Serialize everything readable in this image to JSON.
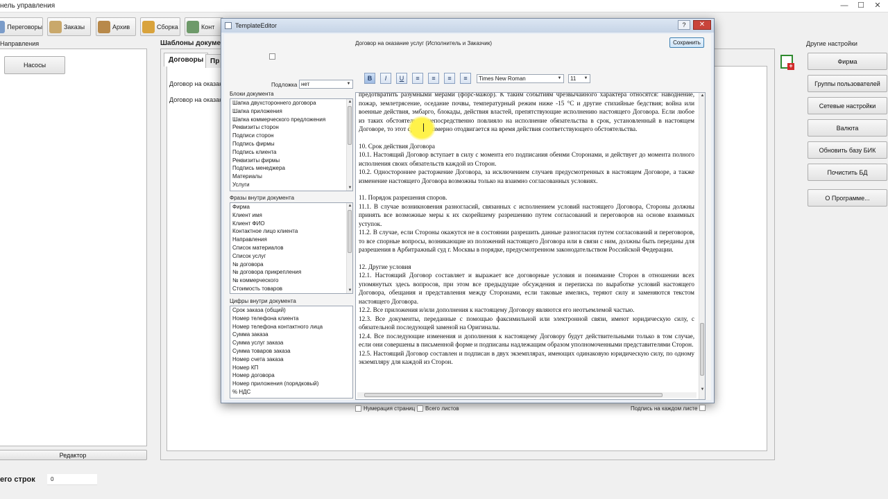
{
  "window": {
    "title": "нель управления"
  },
  "toolbar": {
    "items": [
      {
        "label": "Переговоры",
        "icon": "chat-icon"
      },
      {
        "label": "Заказы",
        "icon": "cart-icon"
      },
      {
        "label": "Архив",
        "icon": "box-icon"
      },
      {
        "label": "Сборка",
        "icon": "tools-icon"
      },
      {
        "label": "Конт",
        "icon": "contacts-icon"
      }
    ]
  },
  "left": {
    "section": "Направления",
    "items": [
      "Насосы"
    ],
    "editor_button": "Редактор"
  },
  "templates": {
    "title": "Шаблоны докумен",
    "tabs": [
      "Договоры",
      "Пр"
    ],
    "docs": [
      "Договор на оказани",
      "Договор на оказани"
    ]
  },
  "footer": {
    "rows_label": "его строк",
    "rows_value": "0"
  },
  "settings": {
    "title": "Другие настройки",
    "buttons": [
      "Фирма",
      "Группы пользователей",
      "Сетевые настройки",
      "Валюта",
      "Обновить базу БИК",
      "Почистить БД",
      "О Программе..."
    ]
  },
  "dialog": {
    "title": "TemplateEditor",
    "help": "?",
    "close": "✕",
    "doc_name": "Договор на оказание услуг (Исполнитель и Заказчик)",
    "save": "Сохранить",
    "substrate_label": "Подложка",
    "substrate_value": "нет",
    "blocks_label": "Блоки документа",
    "blocks": [
      "Шапка двухстороннего договора",
      "Шапка приложения",
      "Шапка коммерческого предложения",
      "Реквизиты сторон",
      "Подписи сторон",
      "Подпись фирмы",
      "Подпись клиента",
      "Реквизиты фирмы",
      "Подпись менеджера",
      "Материалы",
      "Услуги"
    ],
    "phrases_label": "Фразы внутри документа",
    "phrases": [
      "Фирма",
      "Клиент имя",
      "Клиент ФИО",
      "Контактное лицо клиента",
      "Направления",
      "Список материалов",
      "Список услуг",
      "№ договора",
      "№ договора прикрепления",
      "№ коммерческого",
      "Стоимость товаров"
    ],
    "numbers_label": "Цифры внутри документа",
    "numbers": [
      "Срок заказа (общий)",
      "Номер телефона клиента",
      "Номер телефона контактного лица",
      "Сумма заказа",
      "Сумма услуг заказа",
      "Сумма товаров заказа",
      "Номер счета заказа",
      "Номер КП",
      "Номер договора",
      "Номер приложения (порядковый)",
      "% НДС"
    ],
    "font": "Times New Roman",
    "size": "11",
    "format_buttons": [
      "B",
      "I",
      "U",
      "≡",
      "≡",
      "≡",
      "≡"
    ],
    "page_numbering": "Нумерация страниц",
    "total_sheets": "Всего листов",
    "sign_each": "Подпись на каждом листе",
    "text": [
      "предотвратить разумными мерами (форс-мажор). К таким событиям чрезвычайного характера относятся: наводнение, пожар, землетрясение, оседание почвы, температурный режим ниже -15 °С и другие стихийные бедствия; война или военные действия, эмбарго, блокады, действия властей, препятствующие исполнению настоящего Договора. Если любое из таких обстоятельств непосредственно повлияло на исполнение обязательства в срок, установленный в настоящем Договоре, то этот срок соразмерно отодвигается на время действия соответствующего обстоятельства.",
      "",
      "10. Срок действия Договора",
      "10.1. Настоящий Договор вступает в силу с момента его подписания обеими Сторонами, и действует до момента полного исполнения своих обязательств каждой из Сторон.",
      "10.2. Одностороннее расторжение Договора, за исключением случаев предусмотренных в настоящем Договоре, а также изменение настоящего Договора возможны только на взаимно согласованных условиях.",
      "",
      "11. Порядок разрешения споров.",
      "11.1. В случае возникновения разногласий, связанных с исполнением условий настоящего Договора, Стороны должны принять все возможные меры к их скорейшему разрешению путем согласований и переговоров на основе взаимных уступок.",
      "11.2. В случае, если Стороны окажутся не в состоянии разрешить данные разногласия путем согласований и переговоров, то все спорные вопросы, возникающие из положений настоящего Договора или в связи с ним, должны быть переданы для разрешения в Арбитражный суд г. Москвы в порядке, предусмотренном законодательством Российской Федерации.",
      "",
      "12. Другие условия",
      "12.1. Настоящий Договор составляет и выражает все договорные условия и понимание Сторон в отношении всех упомянутых здесь вопросов, при этом все предыдущие обсуждения и переписка по выработке условий настоящего Договора, обещания и представления между Сторонами, если таковые имелись, теряют силу и заменяются текстом настоящего Договора.",
      "12.2. Все приложения и/или дополнения к настоящему Договору являются его неотъемлемой частью.",
      "12.3. Все документы, переданные с помощью факсимильной или электронной связи, имеют юридическую силу, с обязательной последующей заменой на Оригиналы.",
      "12.4. Все последующие изменения и дополнения к настоящему Договору будут действительными только в том случае, если они совершены в письменной форме и подписаны надлежащим образом уполномоченными представителями Сторон.",
      "12.5. Настоящий Договор составлен и подписан в двух экземплярах, имеющих одинаковую юридическую силу, по одному экземпляру для каждой из Сторон."
    ]
  }
}
